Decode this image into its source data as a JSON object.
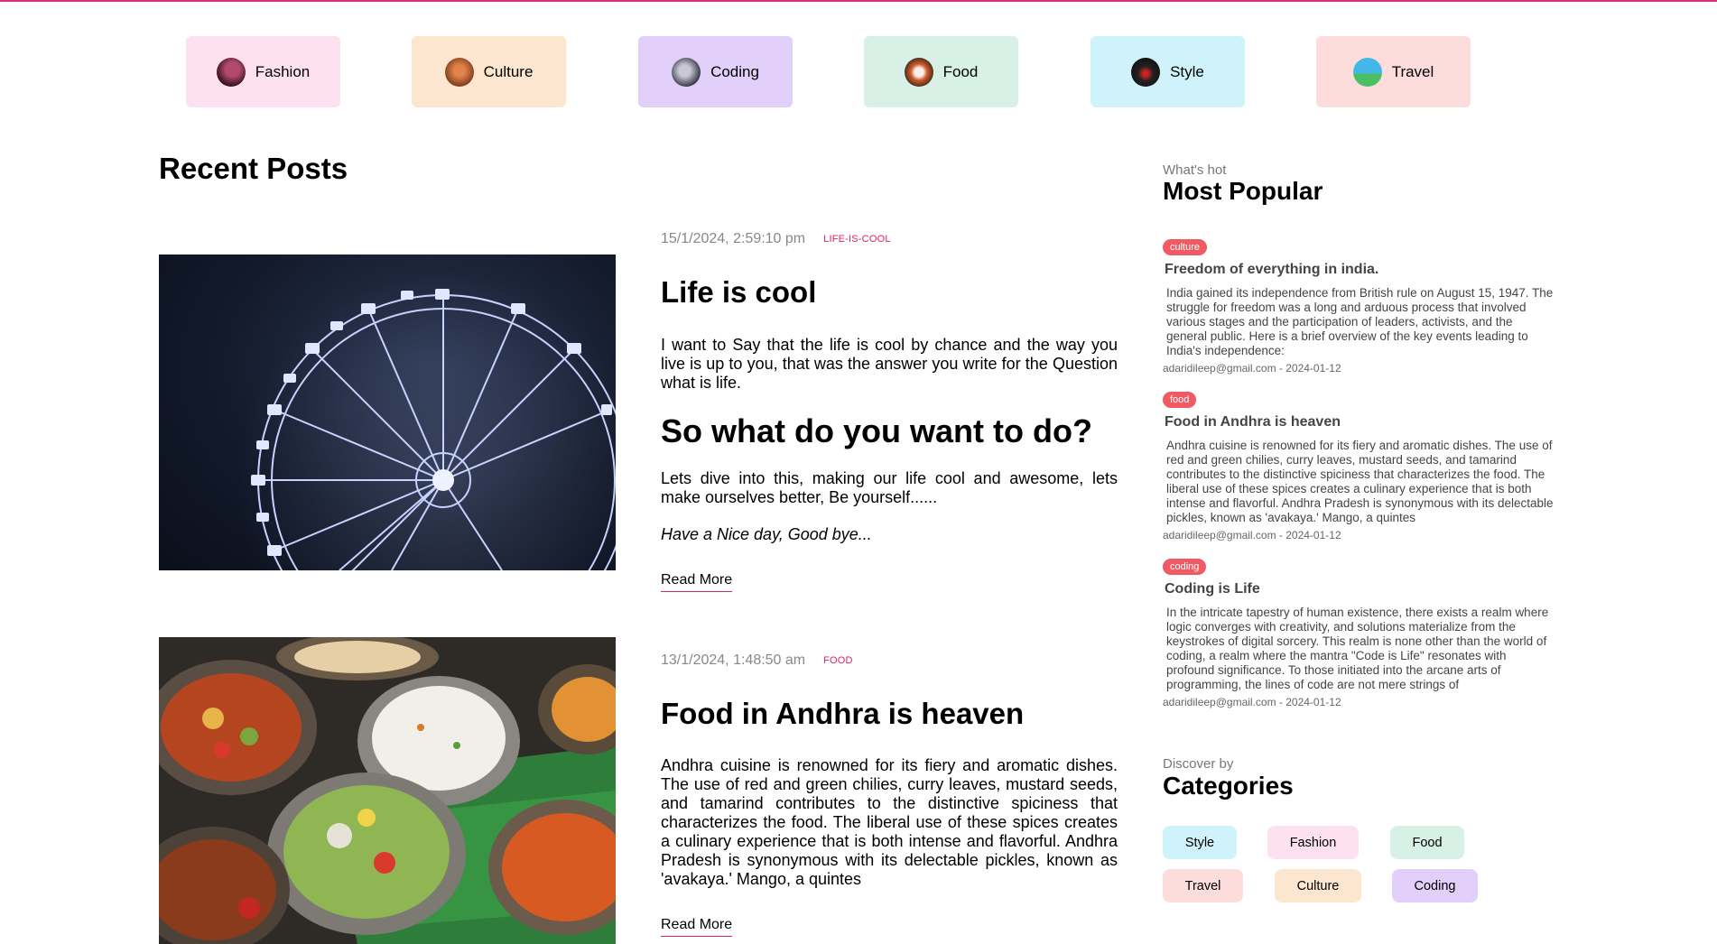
{
  "colors": {
    "accent": "#e0245e",
    "fashion": "#fde1ef",
    "culture": "#fde6cf",
    "coding": "#e2d0fb",
    "food": "#d8f1e6",
    "style": "#d0f3fb",
    "travel": "#fddcdc",
    "chip": "#f05a63"
  },
  "categories_bar": [
    {
      "label": "Fashion",
      "icon": "fashion-avatar-icon"
    },
    {
      "label": "Culture",
      "icon": "culture-avatar-icon"
    },
    {
      "label": "Coding",
      "icon": "coding-avatar-icon"
    },
    {
      "label": "Food",
      "icon": "food-avatar-icon"
    },
    {
      "label": "Style",
      "icon": "style-avatar-icon"
    },
    {
      "label": "Travel",
      "icon": "travel-avatar-icon"
    }
  ],
  "recent": {
    "title": "Recent Posts",
    "posts": [
      {
        "date": "15/1/2024, 2:59:10 pm",
        "tag": "LIFE-IS-COOL",
        "image": "ferris-wheel-image",
        "title": "Life is cool",
        "body1": "I want to Say that the life is cool by chance and the way you live is up to you, that was the answer you write for the Question what is life.",
        "heading2": "So what do you want to do?",
        "body2": "Lets dive into this, making our life cool and awesome, lets make ourselves better, Be yourself......",
        "body3": "Have a Nice day, Good bye...",
        "read_more": "Read More"
      },
      {
        "date": "13/1/2024, 1:48:50 am",
        "tag": "FOOD",
        "image": "andhra-food-image",
        "title": "Food in Andhra is heaven",
        "body1": "Andhra cuisine is renowned for its fiery and aromatic dishes. The use of red and green chilies, curry leaves, mustard seeds, and tamarind contributes to the distinctive spiciness that characterizes the food. The liberal use of these spices creates a culinary experience that is both intense and flavorful. Andhra Pradesh is synonymous with its delectable pickles, known as 'avakaya.' Mango, a quintes",
        "read_more": "Read More"
      }
    ]
  },
  "popular": {
    "subtitle": "What's hot",
    "title": "Most Popular",
    "items": [
      {
        "chip": "culture",
        "title": "Freedom of everything in india.",
        "desc": "India gained its independence from British rule on August 15, 1947. The struggle for freedom was a long and arduous process that involved various stages and the participation of leaders, activists, and the general public. Here is a brief overview of the key events leading to India's independence:",
        "meta": "adaridileep@gmail.com - 2024-01-12"
      },
      {
        "chip": "food",
        "title": "Food in Andhra is heaven",
        "desc": "Andhra cuisine is renowned for its fiery and aromatic dishes. The use of red and green chilies, curry leaves, mustard seeds, and tamarind contributes to the distinctive spiciness that characterizes the food. The liberal use of these spices creates a culinary experience that is both intense and flavorful. Andhra Pradesh is synonymous with its delectable pickles, known as 'avakaya.' Mango, a quintes",
        "meta": "adaridileep@gmail.com - 2024-01-12"
      },
      {
        "chip": "coding",
        "title": "Coding is Life",
        "desc": "In the intricate tapestry of human existence, there exists a realm where logic converges with creativity, and solutions materialize from the keystrokes of digital sorcery. This realm is none other than the world of coding, a realm where the mantra \"Code is Life\" resonates with profound significance. To those initiated into the arcane arts of programming, the lines of code are not mere strings of",
        "meta": "adaridileep@gmail.com - 2024-01-12"
      }
    ]
  },
  "categories": {
    "subtitle": "Discover by",
    "title": "Categories",
    "items": [
      "Style",
      "Fashion",
      "Food",
      "Travel",
      "Culture",
      "Coding"
    ]
  }
}
